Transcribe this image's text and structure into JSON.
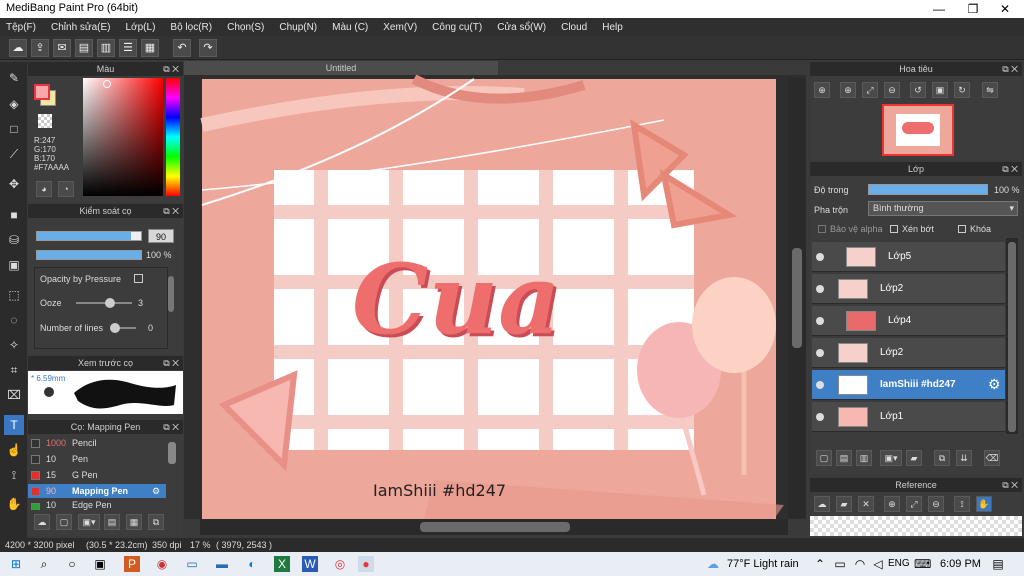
{
  "window": {
    "title": "MediBang Paint Pro (64bit)",
    "minimize": "—",
    "maximize": "❐",
    "close": "✕"
  },
  "menu": [
    "Tệp(F)",
    "Chỉnh sửa(E)",
    "Lớp(L)",
    "Bộ lọc(R)",
    "Chọn(S)",
    "Chụp(N)",
    "Màu (C)",
    "Xem(V)",
    "Công cụ(T)",
    "Cửa sổ(W)",
    "Cloud",
    "Help"
  ],
  "color_panel": {
    "title": "Màu",
    "r": "R:247",
    "g": "G:170",
    "b": "B:170",
    "hex": "#F7AAAA",
    "primary_color": "#F7AAAA",
    "secondary_color": "#F5E6A0"
  },
  "brush_control": {
    "title": "Kiểm soát cọ",
    "size_value": "90",
    "size_fraction": 0.9,
    "opacity_value": "100 %",
    "opacity_fraction": 1.0,
    "opacity_pressure_label": "Opacity by Pressure",
    "ooze_label": "Ooze",
    "ooze_value": "3",
    "ooze_fraction": 0.6,
    "lines_label": "Number of lines",
    "lines_value": "0",
    "lines_fraction": 0.05
  },
  "brush_preview": {
    "title": "Xem trước cọ",
    "size": "* 6.59mm"
  },
  "brush_list": {
    "title": "Cọ: Mapping Pen",
    "items": [
      {
        "size": "1000",
        "name": "Pencil",
        "swatch": "#333333",
        "selected": false
      },
      {
        "size": "10",
        "name": "Pen",
        "swatch": "#333333",
        "selected": false
      },
      {
        "size": "15",
        "name": "G Pen",
        "swatch": "#e03030",
        "selected": false
      },
      {
        "size": "90",
        "name": "Mapping Pen",
        "swatch": "#e03030",
        "selected": true
      },
      {
        "size": "10",
        "name": "Edge Pen",
        "swatch": "#30a030",
        "selected": false
      }
    ]
  },
  "document": {
    "tab_title": "Untitled",
    "canvas_text": "IamShiii #hd247",
    "lettering": "Cua"
  },
  "navigator": {
    "title": "Hoa tiêu"
  },
  "layer_panel": {
    "title": "Lớp",
    "opacity_label": "Độ trong",
    "opacity_value": "100 %",
    "opacity_fraction": 1.0,
    "blend_label": "Pha trộn",
    "blend_value": "Bình thường",
    "alpha_protect": "Bảo vệ alpha",
    "clipping": "Xén bớt",
    "lock": "Khóa",
    "layers": [
      {
        "name": "Lớp5",
        "selected": false
      },
      {
        "name": "Lớp2",
        "selected": false
      },
      {
        "name": "Lớp4",
        "selected": false
      },
      {
        "name": "Lớp2",
        "selected": false
      },
      {
        "name": "IamShiii #hd247",
        "selected": true
      },
      {
        "name": "Lớp1",
        "selected": false
      }
    ]
  },
  "reference": {
    "title": "Reference"
  },
  "status": {
    "size": "4200 * 3200 pixel",
    "cm": "(30.5 * 23.2cm)",
    "dpi": "350 dpi",
    "zoom": "17 %",
    "coords": "( 3979, 2543 )"
  },
  "taskbar": {
    "weather": "77°F  Light rain",
    "lang": "ENG",
    "time": "6:09 PM"
  }
}
